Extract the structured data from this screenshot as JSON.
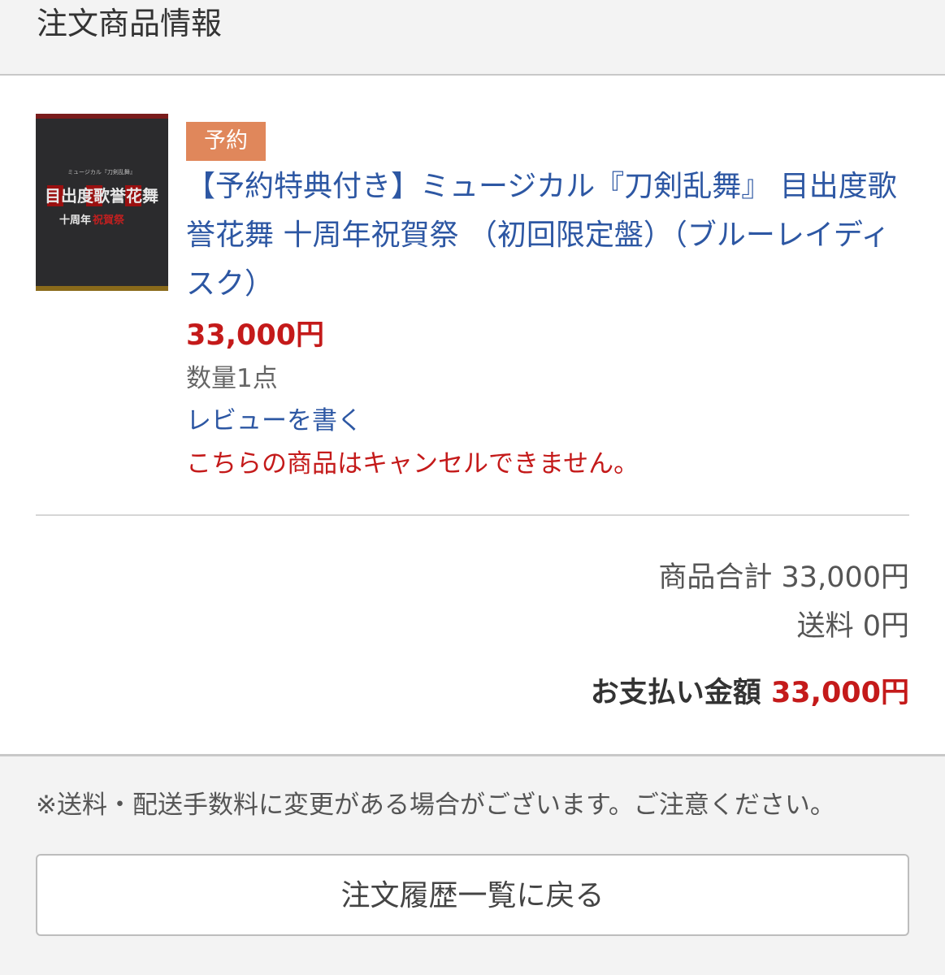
{
  "section": {
    "title": "注文商品情報"
  },
  "product": {
    "badge": "予約",
    "title": "【予約特典付き】ミュージカル『刀剣乱舞』 目出度歌誉花舞 十周年祝賀祭 （初回限定盤）（ブルーレイディスク）",
    "price": "33,000円",
    "quantity": "数量1点",
    "review_link": "レビューを書く",
    "cancel_note": "こちらの商品はキャンセルできません。",
    "thumbnail": {
      "top_text": "ミュージカル『刀剣乱舞』",
      "main_text": "目出度歌誉花舞",
      "sub_text": "十周年",
      "sub_text_red": "祝賀祭"
    }
  },
  "totals": {
    "subtotal": "商品合計 33,000円",
    "shipping": "送料 0円",
    "grand_label": "お支払い金額",
    "grand_amount": "33,000円"
  },
  "footer": {
    "notice": "※送料・配送手数料に変更がある場合がございます。ご注意ください。",
    "back_button": "注文履歴一覧に戻る"
  },
  "colors": {
    "link": "#2d57a3",
    "price_red": "#c41a1a",
    "badge": "#e0875b",
    "background": "#f3f3f3"
  }
}
